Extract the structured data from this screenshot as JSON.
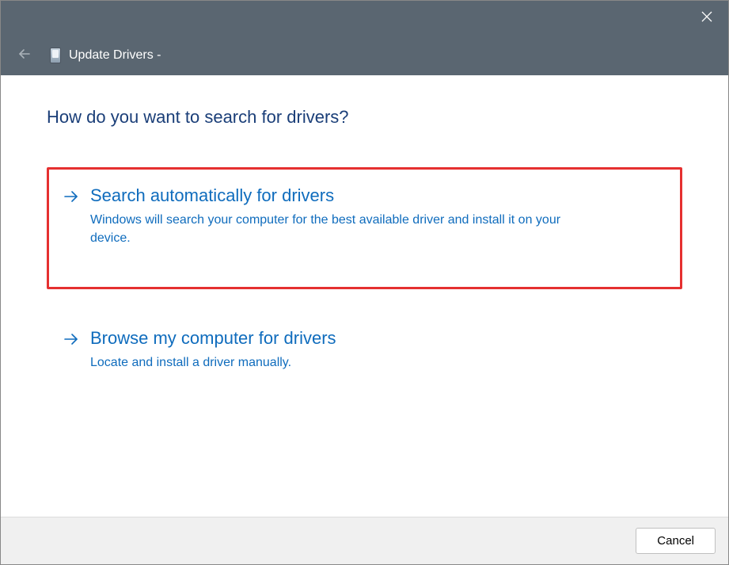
{
  "titlebar": {
    "window_title": "Update Drivers -"
  },
  "heading": "How do you want to search for drivers?",
  "options": [
    {
      "title": "Search automatically for drivers",
      "description": "Windows will search your computer for the best available driver and install it on your device."
    },
    {
      "title": "Browse my computer for drivers",
      "description": "Locate and install a driver manually."
    }
  ],
  "footer": {
    "cancel_label": "Cancel"
  }
}
